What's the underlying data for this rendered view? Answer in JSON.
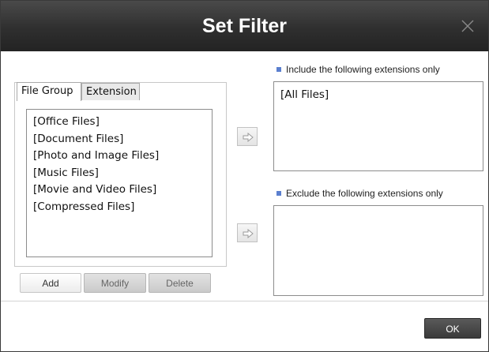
{
  "dialog": {
    "title": "Set Filter"
  },
  "tabs": [
    {
      "label": "File Group",
      "active": true
    },
    {
      "label": "Extension",
      "active": false
    }
  ],
  "file_groups": [
    "[Office Files]",
    "[Document Files]",
    "[Photo and Image Files]",
    "[Music Files]",
    "[Movie and Video Files]",
    "[Compressed Files]"
  ],
  "buttons": {
    "add": "Add",
    "modify": "Modify",
    "delete": "Delete",
    "ok": "OK"
  },
  "include": {
    "label": "Include the following extensions only",
    "items": [
      "[All Files]"
    ]
  },
  "exclude": {
    "label": "Exclude the following extensions only",
    "items": []
  },
  "icons": {
    "close": "close-icon",
    "arrow": "arrow-right-icon",
    "bullet": "square-bullet-icon"
  },
  "colors": {
    "titlebar": "#2f2f2f",
    "accent": "#5b7fcf",
    "ok_button": "#4a4a4a"
  }
}
